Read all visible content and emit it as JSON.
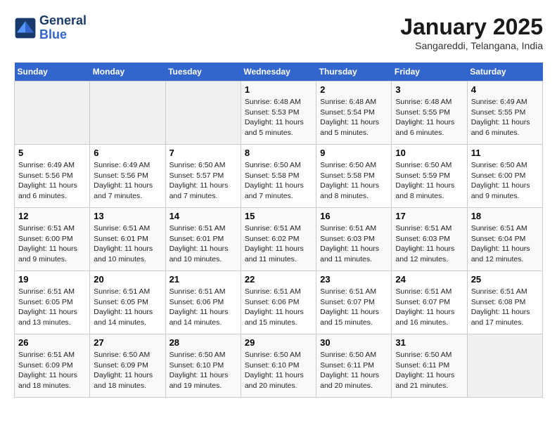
{
  "header": {
    "logo_line1": "General",
    "logo_line2": "Blue",
    "month": "January 2025",
    "location": "Sangareddi, Telangana, India"
  },
  "weekdays": [
    "Sunday",
    "Monday",
    "Tuesday",
    "Wednesday",
    "Thursday",
    "Friday",
    "Saturday"
  ],
  "weeks": [
    [
      {
        "day": "",
        "info": ""
      },
      {
        "day": "",
        "info": ""
      },
      {
        "day": "",
        "info": ""
      },
      {
        "day": "1",
        "info": "Sunrise: 6:48 AM\nSunset: 5:53 PM\nDaylight: 11 hours\nand 5 minutes."
      },
      {
        "day": "2",
        "info": "Sunrise: 6:48 AM\nSunset: 5:54 PM\nDaylight: 11 hours\nand 5 minutes."
      },
      {
        "day": "3",
        "info": "Sunrise: 6:48 AM\nSunset: 5:55 PM\nDaylight: 11 hours\nand 6 minutes."
      },
      {
        "day": "4",
        "info": "Sunrise: 6:49 AM\nSunset: 5:55 PM\nDaylight: 11 hours\nand 6 minutes."
      }
    ],
    [
      {
        "day": "5",
        "info": "Sunrise: 6:49 AM\nSunset: 5:56 PM\nDaylight: 11 hours\nand 6 minutes."
      },
      {
        "day": "6",
        "info": "Sunrise: 6:49 AM\nSunset: 5:56 PM\nDaylight: 11 hours\nand 7 minutes."
      },
      {
        "day": "7",
        "info": "Sunrise: 6:50 AM\nSunset: 5:57 PM\nDaylight: 11 hours\nand 7 minutes."
      },
      {
        "day": "8",
        "info": "Sunrise: 6:50 AM\nSunset: 5:58 PM\nDaylight: 11 hours\nand 7 minutes."
      },
      {
        "day": "9",
        "info": "Sunrise: 6:50 AM\nSunset: 5:58 PM\nDaylight: 11 hours\nand 8 minutes."
      },
      {
        "day": "10",
        "info": "Sunrise: 6:50 AM\nSunset: 5:59 PM\nDaylight: 11 hours\nand 8 minutes."
      },
      {
        "day": "11",
        "info": "Sunrise: 6:50 AM\nSunset: 6:00 PM\nDaylight: 11 hours\nand 9 minutes."
      }
    ],
    [
      {
        "day": "12",
        "info": "Sunrise: 6:51 AM\nSunset: 6:00 PM\nDaylight: 11 hours\nand 9 minutes."
      },
      {
        "day": "13",
        "info": "Sunrise: 6:51 AM\nSunset: 6:01 PM\nDaylight: 11 hours\nand 10 minutes."
      },
      {
        "day": "14",
        "info": "Sunrise: 6:51 AM\nSunset: 6:01 PM\nDaylight: 11 hours\nand 10 minutes."
      },
      {
        "day": "15",
        "info": "Sunrise: 6:51 AM\nSunset: 6:02 PM\nDaylight: 11 hours\nand 11 minutes."
      },
      {
        "day": "16",
        "info": "Sunrise: 6:51 AM\nSunset: 6:03 PM\nDaylight: 11 hours\nand 11 minutes."
      },
      {
        "day": "17",
        "info": "Sunrise: 6:51 AM\nSunset: 6:03 PM\nDaylight: 11 hours\nand 12 minutes."
      },
      {
        "day": "18",
        "info": "Sunrise: 6:51 AM\nSunset: 6:04 PM\nDaylight: 11 hours\nand 12 minutes."
      }
    ],
    [
      {
        "day": "19",
        "info": "Sunrise: 6:51 AM\nSunset: 6:05 PM\nDaylight: 11 hours\nand 13 minutes."
      },
      {
        "day": "20",
        "info": "Sunrise: 6:51 AM\nSunset: 6:05 PM\nDaylight: 11 hours\nand 14 minutes."
      },
      {
        "day": "21",
        "info": "Sunrise: 6:51 AM\nSunset: 6:06 PM\nDaylight: 11 hours\nand 14 minutes."
      },
      {
        "day": "22",
        "info": "Sunrise: 6:51 AM\nSunset: 6:06 PM\nDaylight: 11 hours\nand 15 minutes."
      },
      {
        "day": "23",
        "info": "Sunrise: 6:51 AM\nSunset: 6:07 PM\nDaylight: 11 hours\nand 15 minutes."
      },
      {
        "day": "24",
        "info": "Sunrise: 6:51 AM\nSunset: 6:07 PM\nDaylight: 11 hours\nand 16 minutes."
      },
      {
        "day": "25",
        "info": "Sunrise: 6:51 AM\nSunset: 6:08 PM\nDaylight: 11 hours\nand 17 minutes."
      }
    ],
    [
      {
        "day": "26",
        "info": "Sunrise: 6:51 AM\nSunset: 6:09 PM\nDaylight: 11 hours\nand 18 minutes."
      },
      {
        "day": "27",
        "info": "Sunrise: 6:50 AM\nSunset: 6:09 PM\nDaylight: 11 hours\nand 18 minutes."
      },
      {
        "day": "28",
        "info": "Sunrise: 6:50 AM\nSunset: 6:10 PM\nDaylight: 11 hours\nand 19 minutes."
      },
      {
        "day": "29",
        "info": "Sunrise: 6:50 AM\nSunset: 6:10 PM\nDaylight: 11 hours\nand 20 minutes."
      },
      {
        "day": "30",
        "info": "Sunrise: 6:50 AM\nSunset: 6:11 PM\nDaylight: 11 hours\nand 20 minutes."
      },
      {
        "day": "31",
        "info": "Sunrise: 6:50 AM\nSunset: 6:11 PM\nDaylight: 11 hours\nand 21 minutes."
      },
      {
        "day": "",
        "info": ""
      }
    ]
  ]
}
